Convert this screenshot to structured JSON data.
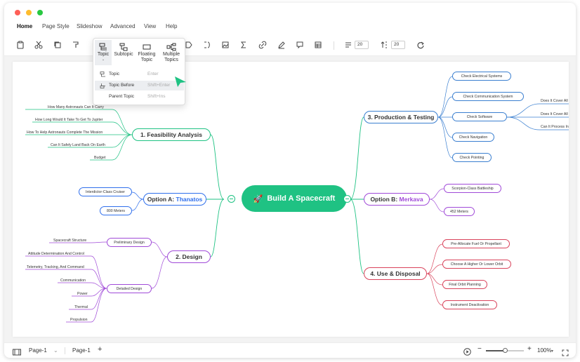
{
  "window": {
    "colors": {
      "red": "#fe5f57",
      "yellow": "#febc2e",
      "green": "#28c840"
    }
  },
  "menu": [
    "Home",
    "Page Style",
    "Slideshow",
    "Advanced",
    "View",
    "Help"
  ],
  "toolbar": {
    "icons": [
      "clipboard-icon",
      "cut-icon",
      "copy-icon",
      "format-painter-icon",
      "shape-icon",
      "connector-icon",
      "image-icon",
      "formula-icon",
      "link-icon",
      "pen-icon",
      "comment-icon",
      "table-icon"
    ],
    "spacing_h": "20",
    "spacing_v": "20"
  },
  "insert_menu": {
    "topic": "Topic",
    "subtopic": "Subtopic",
    "floating_line1": "Floating",
    "floating_line2": "Topic",
    "multiple_line1": "Multiple",
    "multiple_line2": "Topics",
    "rows": [
      {
        "label": "Topic",
        "shortcut": "Enter"
      },
      {
        "label": "Topic Before",
        "shortcut": "Shift+Enter"
      },
      {
        "label": "Parent Topic",
        "shortcut": "Shift+Ins"
      }
    ]
  },
  "mindmap": {
    "center": "Build A Spacecraft",
    "colors": {
      "center": "#1fc283",
      "feasibility": "#1fc283",
      "option_a": "#2f6fec",
      "design": "#a04ad8",
      "production": "#3a7fd0",
      "option_b": "#a04ad8",
      "use": "#d9435b"
    },
    "feasibility": {
      "title": "1. Feasibility Analysis",
      "leaves": [
        "How Many Astronauts Can It Carry",
        "How Long Would It Take To Get To Jupiter",
        "How To Help Astronauts Complete The Mission",
        "Can It Safely Land Back On Earth",
        "Budget"
      ]
    },
    "option_a": {
      "prefix": "Option A: ",
      "name": "Thanatos",
      "subs": [
        "Interdictor-Class Cruiser",
        "800 Meters"
      ]
    },
    "design": {
      "title": "2. Design",
      "prelim": "Preliminary Design",
      "prelim_leaves": [
        "Spacecraft Structure"
      ],
      "detailed": "Detailed Design",
      "detailed_leaves": [
        "Attitude Determination And Control",
        "Telemetry, Tracking, And Command",
        "Communication",
        "Power",
        "Thermal",
        "Propulsion"
      ]
    },
    "production": {
      "title": "3. Production & Testing",
      "subs": [
        "Check Electrical Systems",
        "Check Communication System",
        "Check Software",
        "Check Navigation",
        "Check Pointing"
      ],
      "software_leaves": [
        "Does It Cover All",
        "Does It Cover All",
        "Can It Process In"
      ]
    },
    "option_b": {
      "prefix": "Option B: ",
      "name": "Merkava",
      "subs": [
        "Scorpion-Class Battleship",
        "452 Meters"
      ]
    },
    "use": {
      "title": "4. Use & Disposal",
      "subs": [
        "Pre-Allocate Fuel Or Propellant",
        "Choose A Higher Or Lower Orbit",
        "Final Orbit Planning",
        "Instrument Deactivation"
      ]
    }
  },
  "status": {
    "page_select": "Page-1",
    "page_tab": "Page-1",
    "zoom": "100%",
    "zoom_level": 0.5
  }
}
